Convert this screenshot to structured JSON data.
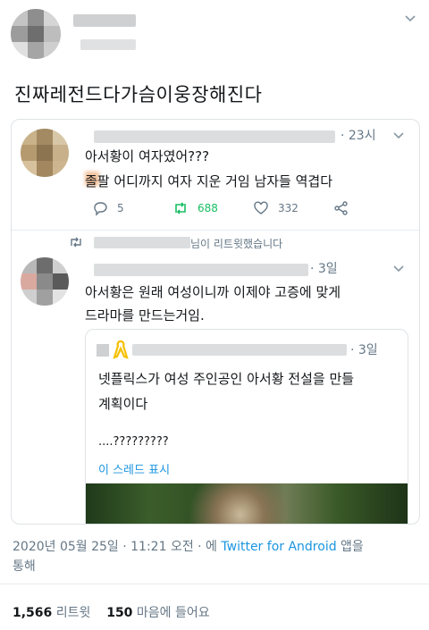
{
  "tweet": {
    "text": "진짜레전드다가슴이웅장해진다"
  },
  "quoted_tweet": {
    "time": "· 23시",
    "line1": "아서황이 여자였어???",
    "line2": "졸팔 어디까지 여자 지운 거임 남자들 역겹다",
    "replies": "5",
    "retweets": "688",
    "likes": "332"
  },
  "retweet_notice": {
    "suffix": "님이 리트윗했습니다"
  },
  "nested_tweet": {
    "time": "· 3일",
    "line1": "아서황은 원래 여성이니까 이제야 고증에 맞게",
    "line2": "드라마를 만드는거임."
  },
  "inner_tweet": {
    "time": "· 3일",
    "line1": "넷플릭스가  여성 주인공인 아서황 전설을 만들",
    "line2": "계획이다",
    "line3": "....?????????",
    "thread_link": "이 스레드 표시"
  },
  "meta": {
    "timestamp": "2020년 05월 25일 · 11:21 오전 · 에",
    "via": "Twitter for Android",
    "via_suffix": " 앱을",
    "line2": "통해"
  },
  "stats": {
    "retweet_count": "1,566",
    "retweet_label": " 리트윗",
    "like_count": "150",
    "like_label": " 마음에 들어요"
  },
  "colors": {
    "accent": "#1b95e0",
    "retweet_green": "#17bf63",
    "secondary_text": "#657786"
  }
}
